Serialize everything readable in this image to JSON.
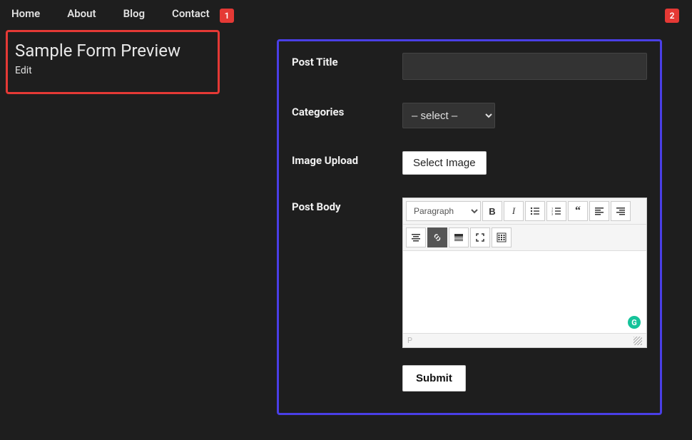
{
  "nav": {
    "items": [
      {
        "label": "Home"
      },
      {
        "label": "About"
      },
      {
        "label": "Blog"
      },
      {
        "label": "Contact"
      }
    ]
  },
  "badges": {
    "one": "1",
    "two": "2"
  },
  "sidebar": {
    "title": "Sample Form Preview",
    "edit": "Edit"
  },
  "form": {
    "post_title_label": "Post Title",
    "post_title_value": "",
    "categories_label": "Categories",
    "categories_selected": "– select –",
    "image_upload_label": "Image Upload",
    "select_image_btn": "Select Image",
    "post_body_label": "Post Body",
    "submit_btn": "Submit"
  },
  "editor": {
    "paragraph_label": "Paragraph",
    "footer_path": "P"
  }
}
